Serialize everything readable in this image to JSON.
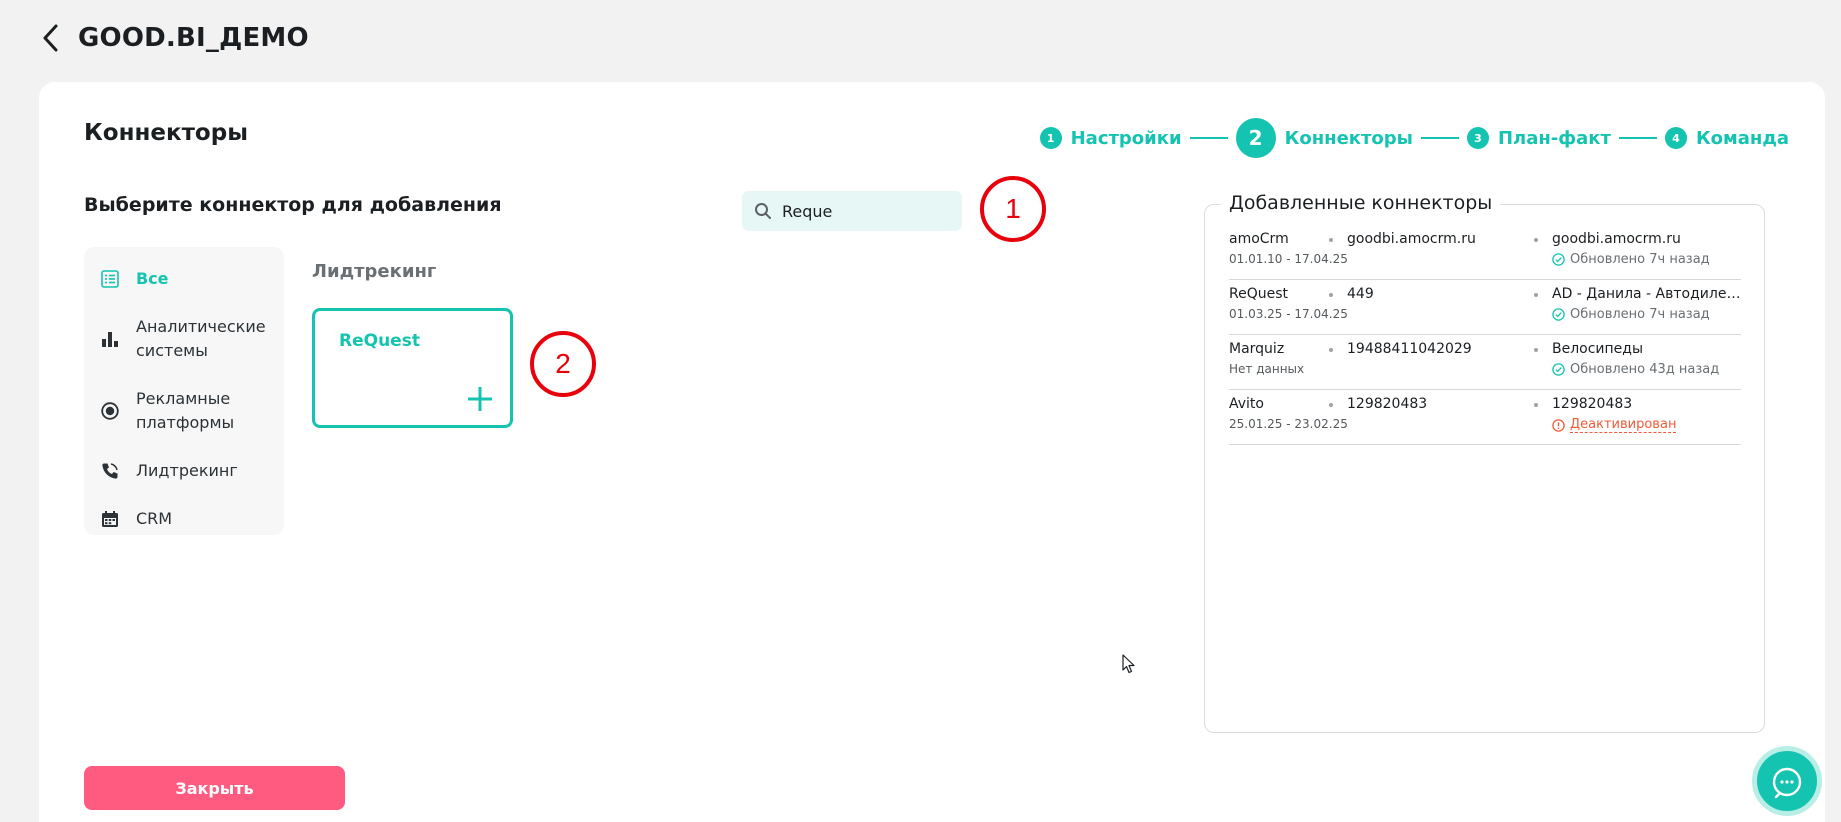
{
  "app": {
    "title": "GOOD.BI_ДЕМО"
  },
  "page": {
    "title": "Коннекторы",
    "section_title": "Выберите коннектор для добавления"
  },
  "stepper": [
    {
      "num": "1",
      "label": "Настройки"
    },
    {
      "num": "2",
      "label": "Коннекторы",
      "active": true
    },
    {
      "num": "3",
      "label": "План-факт"
    },
    {
      "num": "4",
      "label": "Команда"
    }
  ],
  "search": {
    "value": "Reque",
    "icon": "search-icon"
  },
  "annotations": [
    "1",
    "2"
  ],
  "sidebar": {
    "items": [
      {
        "label": "Все",
        "icon": "list-icon",
        "active": true
      },
      {
        "label": "Аналитические системы",
        "icon": "bar-chart-icon"
      },
      {
        "label": "Рекламные платформы",
        "icon": "target-icon"
      },
      {
        "label": "Лидтрекинг",
        "icon": "phone-icon"
      },
      {
        "label": "CRM",
        "icon": "calendar-icon"
      }
    ]
  },
  "results": {
    "category": "Лидтрекинг",
    "connectors": [
      {
        "name": "ReQuest",
        "icon": "plus-icon"
      }
    ]
  },
  "added": {
    "title": "Добавленные коннекторы",
    "rows": [
      {
        "name": "amoCrm",
        "dates": "01.01.10 - 17.04.25",
        "account": "goodbi.amocrm.ru",
        "project": "goodbi.amocrm.ru",
        "status": "Обновлено 7ч назад",
        "status_type": "ok"
      },
      {
        "name": "ReQuest",
        "dates": "01.03.25 - 17.04.25",
        "account": "449",
        "project": "AD - Данила - Автодилер ...",
        "status": "Обновлено 7ч назад",
        "status_type": "ok"
      },
      {
        "name": "Marquiz",
        "dates": "Нет данных",
        "account": "19488411042029",
        "project": "Велосипеды",
        "status": "Обновлено 43д назад",
        "status_type": "ok"
      },
      {
        "name": "Avito",
        "dates": "25.01.25 - 23.02.25",
        "account": "129820483",
        "project": "129820483",
        "status": "Деактивирован",
        "status_type": "warn"
      }
    ]
  },
  "footer": {
    "close_label": "Закрыть"
  },
  "colors": {
    "accent": "#14c4b0",
    "danger": "#ff5a80",
    "warn": "#ef5a3a",
    "annotation": "#e8000b"
  }
}
